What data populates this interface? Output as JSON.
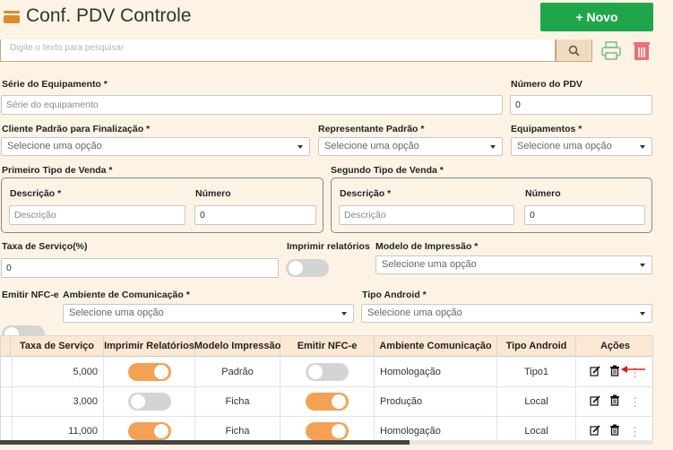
{
  "header": {
    "title": "Conf. PDV Controle",
    "new_button": "+ Novo"
  },
  "search": {
    "placeholder": "Digite o texto para pesquisar"
  },
  "form": {
    "serie_label": "Série do Equipamento *",
    "serie_placeholder": "Série do equipamento",
    "numero_pdv_label": "Número do PDV",
    "numero_pdv_value": "0",
    "cliente_label": "Cliente Padrão para Finalização *",
    "cliente_value": "Selecione uma opção",
    "representante_label": "Representante Padrão *",
    "representante_value": "Selecione uma opção",
    "equipamentos_label": "Equipamentos *",
    "equipamentos_value": "Selecione uma opção",
    "primeiro_tipo": {
      "legend": "Primeiro Tipo de Venda *",
      "descricao_label": "Descrição *",
      "descricao_placeholder": "Descrição",
      "numero_label": "Número",
      "numero_value": "0"
    },
    "segundo_tipo": {
      "legend": "Segundo Tipo de Venda *",
      "descricao_label": "Descrição *",
      "descricao_placeholder": "Descrição",
      "numero_label": "Número",
      "numero_value": "0"
    },
    "taxa_label": "Taxa de Serviço(%)",
    "taxa_value": "0",
    "imprimir_label": "Imprimir relatórios",
    "imprimir_on": false,
    "modelo_label": "Modelo de Impressão *",
    "modelo_value": "Selecione uma opção",
    "nfce_label": "Emitir NFC-e",
    "nfce_on": false,
    "ambiente_label": "Ambiente de Comunicação *",
    "ambiente_value": "Selecione uma opção",
    "android_label": "Tipo Android *",
    "android_value": "Selecione uma opção"
  },
  "table": {
    "headers": [
      "Taxa de Serviço",
      "Imprimir Relatórios",
      "Modelo Impressão",
      "Emitir NFC-e",
      "Ambiente Comunicação",
      "Tipo Android",
      "Ações"
    ],
    "rows": [
      {
        "taxa": "5,000",
        "imprimir": true,
        "modelo": "Padrão",
        "nfce": false,
        "ambiente": "Homologação",
        "android": "Tipo1"
      },
      {
        "taxa": "3,000",
        "imprimir": false,
        "modelo": "Ficha",
        "nfce": true,
        "ambiente": "Produção",
        "android": "Local"
      },
      {
        "taxa": "11,000",
        "imprimir": true,
        "modelo": "Ficha",
        "nfce": true,
        "ambiente": "Homologação",
        "android": "Local"
      }
    ]
  },
  "colors": {
    "accent": "#20a64a",
    "toggle_on": "#f5a155",
    "header_bg": "#fbe8d2",
    "page_bg": "#fdf3e4",
    "arrow": "#e11b1b"
  }
}
